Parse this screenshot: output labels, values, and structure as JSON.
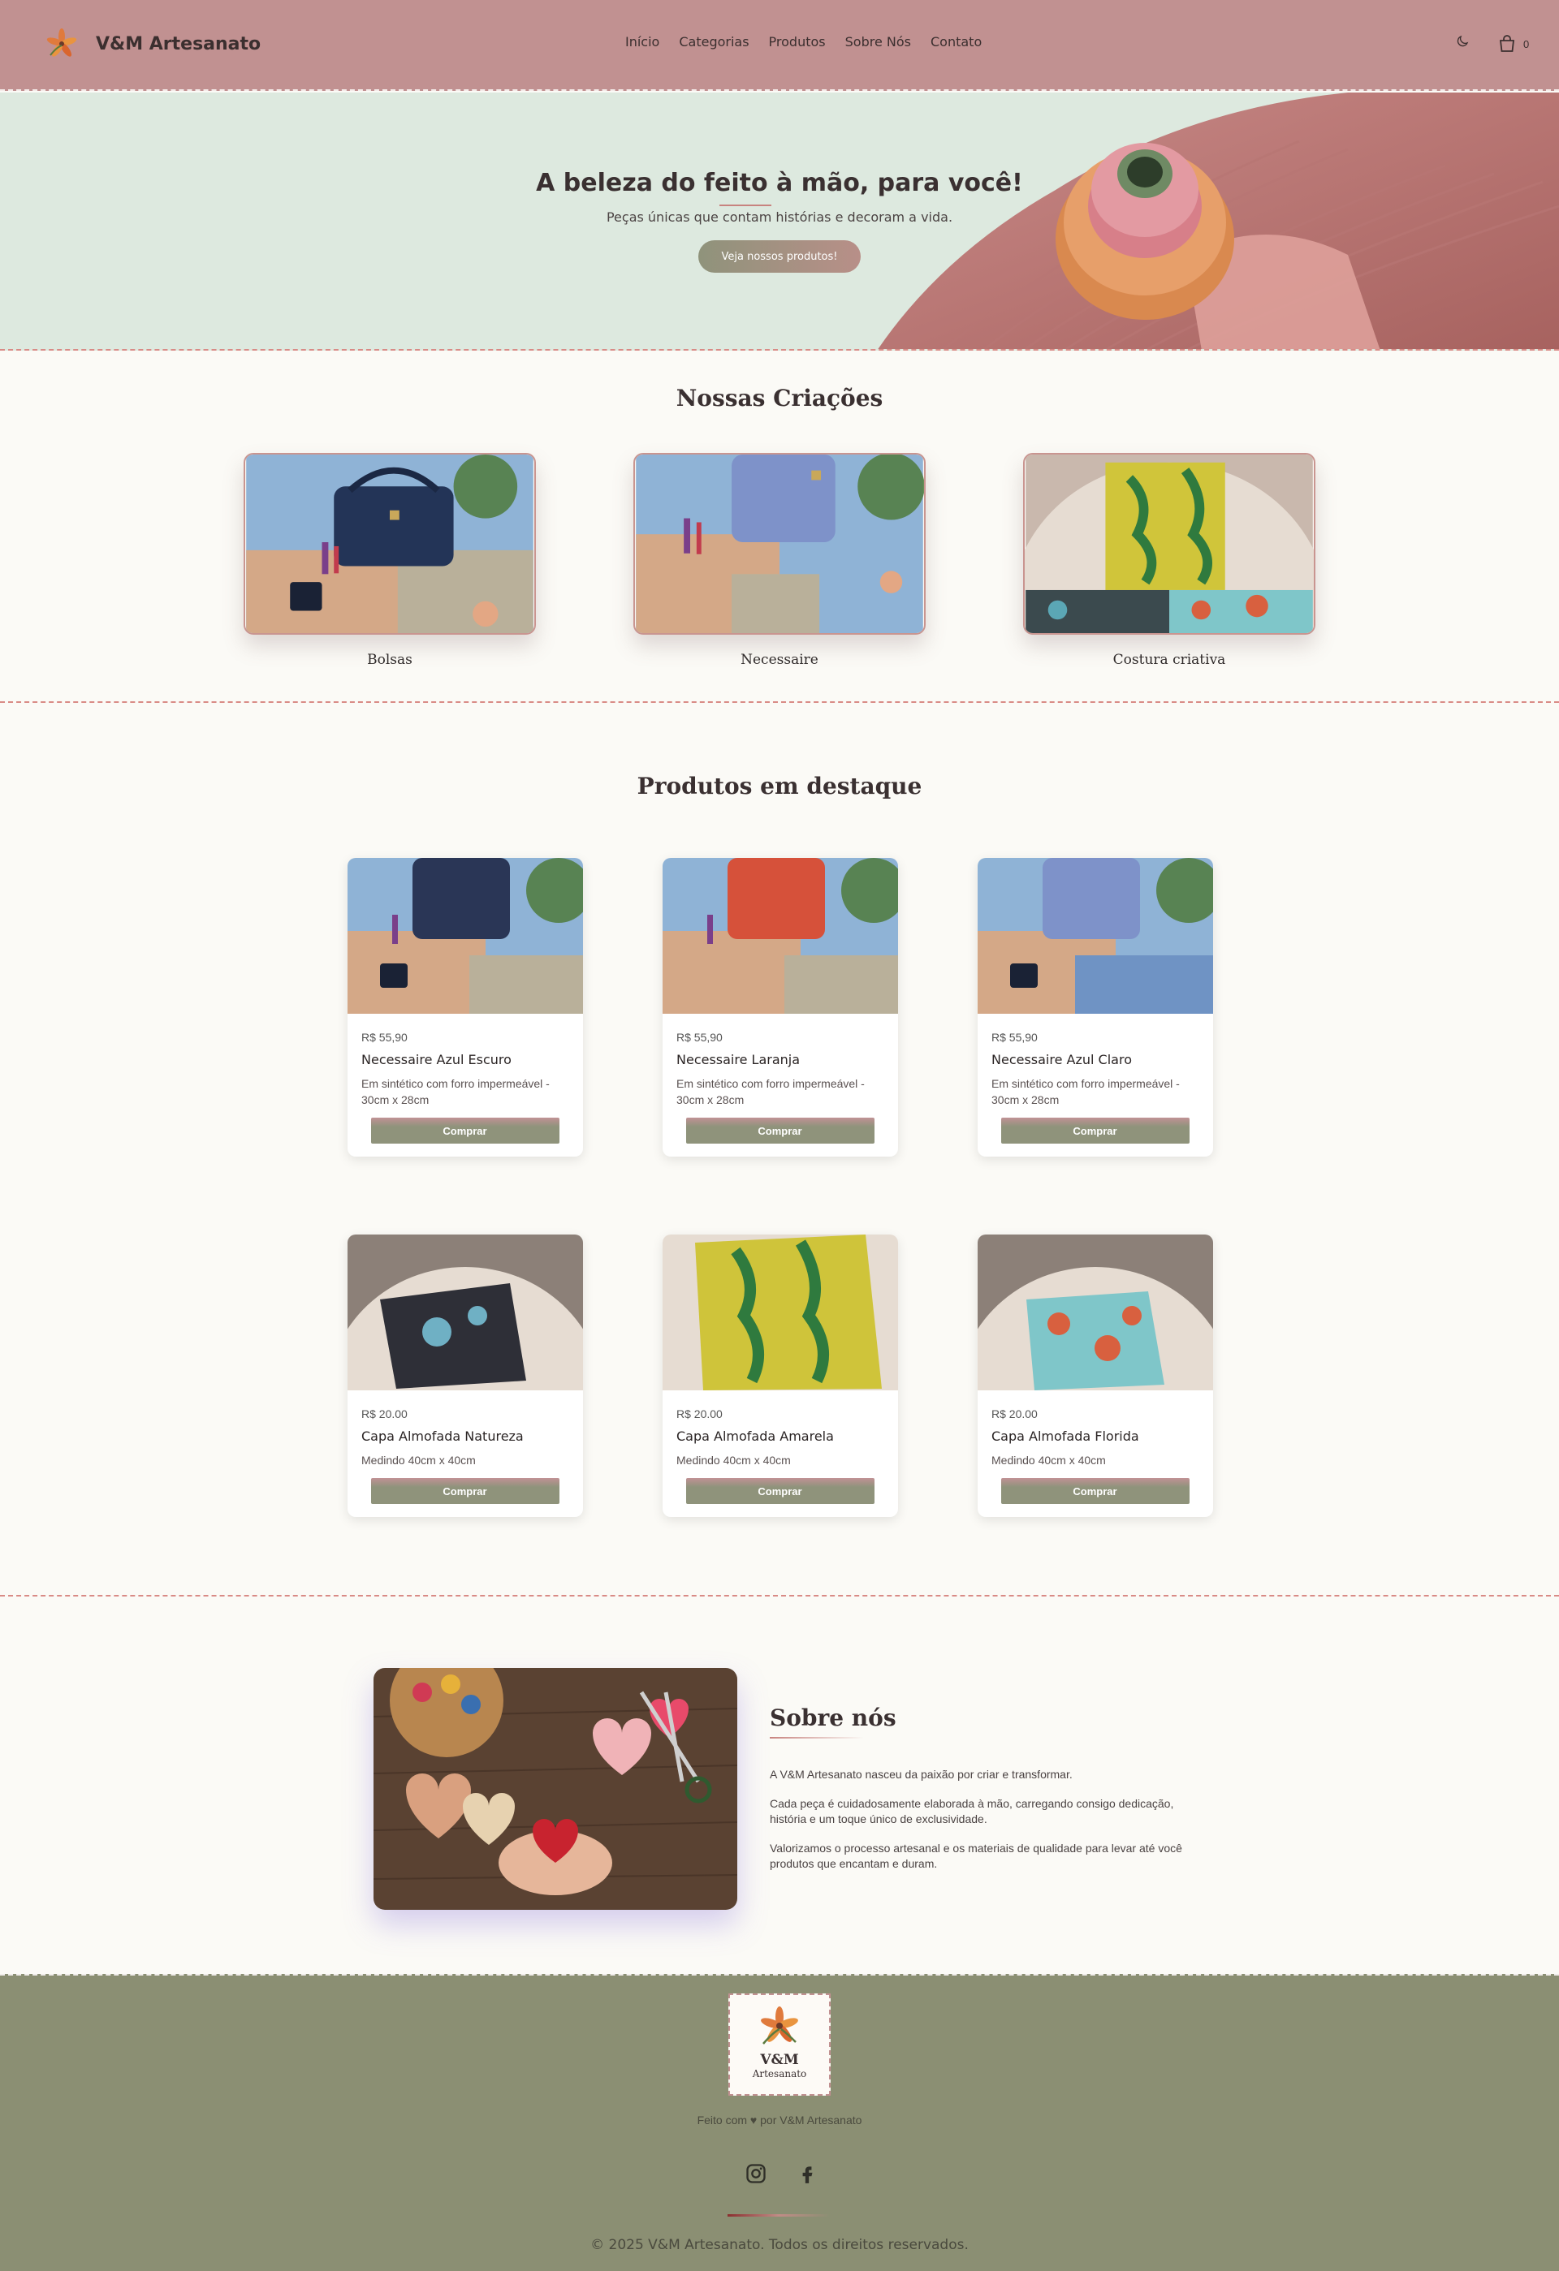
{
  "header": {
    "brand": "V&M Artesanato",
    "nav": [
      "Início",
      "Categorias",
      "Produtos",
      "Sobre Nós",
      "Contato"
    ],
    "cart_count": "0",
    "icons": [
      "logo-flower-icon",
      "moon-icon",
      "shopping-bag-icon"
    ]
  },
  "hero": {
    "title": "A beleza do feito à mão, para você!",
    "subtitle": "Peças únicas que contam histórias e decoram a vida.",
    "cta": "Veja nossos produtos!"
  },
  "creations": {
    "title": "Nossas Criações",
    "items": [
      {
        "label": "Bolsas"
      },
      {
        "label": "Necessaire"
      },
      {
        "label": "Costura criativa"
      }
    ]
  },
  "featured": {
    "title": "Produtos em destaque",
    "buy_label": "Comprar",
    "products": [
      {
        "price": "R$ 55,90",
        "name": "Necessaire Azul Escuro",
        "desc": "Em sintético com forro impermeável - 30cm x 28cm"
      },
      {
        "price": "R$ 55,90",
        "name": "Necessaire Laranja",
        "desc": "Em sintético com forro impermeável - 30cm x 28cm"
      },
      {
        "price": "R$ 55,90",
        "name": "Necessaire Azul Claro",
        "desc": "Em sintético com forro impermeável - 30cm x 28cm"
      },
      {
        "price": "R$ 20.00",
        "name": "Capa Almofada Natureza",
        "desc": "Medindo 40cm x 40cm"
      },
      {
        "price": "R$ 20.00",
        "name": "Capa Almofada Amarela",
        "desc": "Medindo 40cm x 40cm"
      },
      {
        "price": "R$ 20.00",
        "name": "Capa Almofada Florida",
        "desc": "Medindo 40cm x 40cm"
      }
    ]
  },
  "about": {
    "title": "Sobre nós",
    "paragraphs": [
      "A V&M Artesanato nasceu da paixão por criar e transformar.",
      "Cada peça é cuidadosamente elaborada à mão, carregando consigo dedicação, história e um toque único de exclusividade.",
      "Valorizamos o processo artesanal e os materiais de qualidade para levar até você produtos que encantam e duram."
    ]
  },
  "footer": {
    "logo_line1": "V&M",
    "logo_line2": "Artesanato",
    "made_by": "Feito com ♥ por V&M Artesanato",
    "copyright": "© 2025 V&M Artesanato. Todos os direitos reservados.",
    "social": [
      "instagram-icon",
      "facebook-icon"
    ]
  },
  "colors": {
    "header": "#c19191",
    "hero_bg": "#dde9df",
    "page_bg": "#fbfaf6",
    "footer": "#8b8f73",
    "accent": "#d98b86"
  }
}
